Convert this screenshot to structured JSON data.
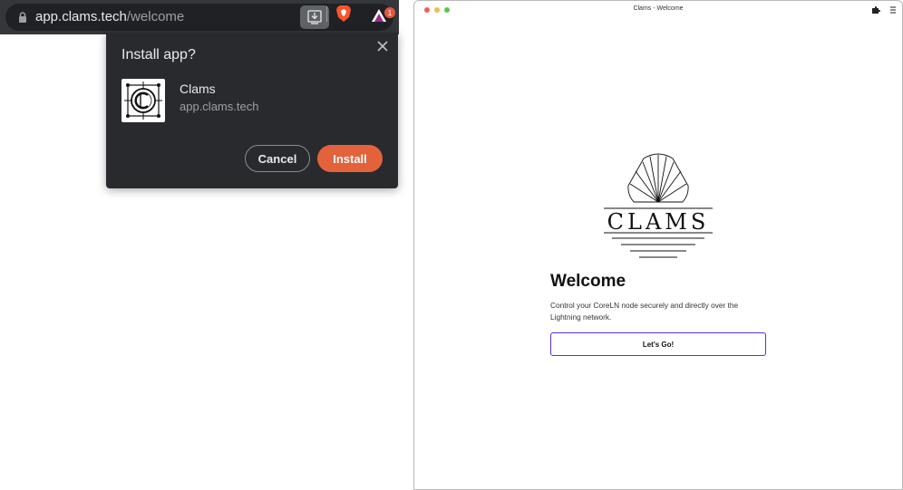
{
  "browser": {
    "url_host": "app.clams.tech",
    "url_path": "/welcome",
    "rewards_badge": "1"
  },
  "install_popup": {
    "title": "Install app?",
    "app_name": "Clams",
    "app_origin": "app.clams.tech",
    "cancel_label": "Cancel",
    "install_label": "Install",
    "accent_color": "#e3623c"
  },
  "app_window": {
    "title": "Clams - Welcome",
    "logo_text": "CLAMS",
    "heading": "Welcome",
    "description": "Control your CoreLN node securely and directly over the Lightning network.",
    "button_label": "Let's Go!",
    "button_border_color": "#5b2bd4"
  },
  "icons": [
    "lock-icon",
    "install-app-icon",
    "brave-icon",
    "brave-rewards-icon",
    "close-icon",
    "clams-app-icon",
    "puzzle-icon",
    "menu-icon",
    "clams-shell-logo"
  ]
}
